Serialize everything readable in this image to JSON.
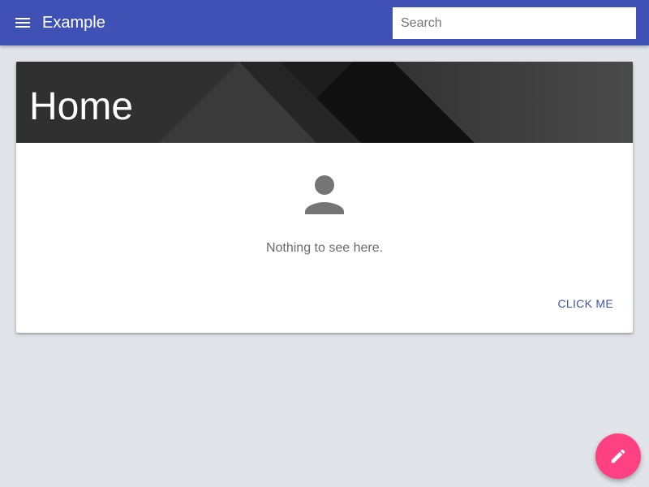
{
  "appbar": {
    "title": "Example",
    "menu_icon": "menu-icon",
    "search": {
      "placeholder": "Search",
      "value": ""
    },
    "color": "#3f51b5"
  },
  "card": {
    "title": "Home",
    "empty_icon": "person-icon",
    "empty_text": "Nothing to see here.",
    "action_label": "CLICK ME"
  },
  "fab": {
    "icon": "edit-icon",
    "color": "#ff4081"
  },
  "colors": {
    "background": "#e1e4e9",
    "accent": "#3f51b5",
    "fab": "#ff4081"
  }
}
